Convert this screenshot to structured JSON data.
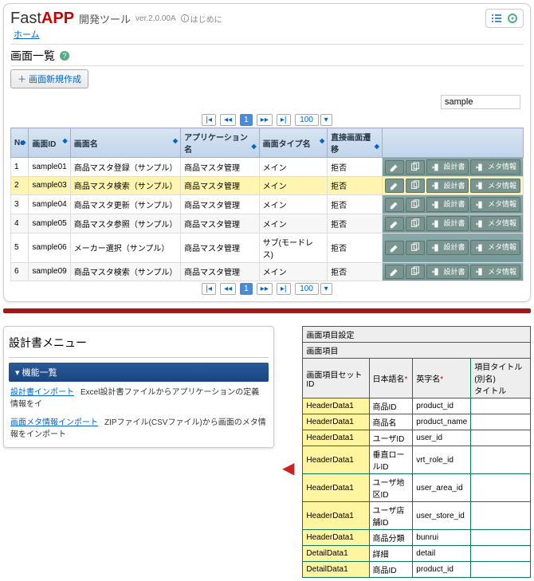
{
  "header": {
    "logo_prefix": "Fast",
    "logo_bold": "APP",
    "subtitle": "開発ツール",
    "version": "ver.2.0.00A",
    "hajime": "はじめに",
    "home": "ホーム"
  },
  "screen_list": {
    "title": "画面一覧",
    "add_button": "＋ 画面新規作成",
    "search_value": "sample",
    "page_size": "100",
    "columns": [
      "No",
      "画面ID",
      "画面名",
      "アプリケーション名",
      "画面タイプ名",
      "直接画面遷移"
    ],
    "action_labels": {
      "design": "設計書",
      "meta": "メタ情報"
    },
    "rows": [
      {
        "no": "1",
        "id": "sample01",
        "name": "商品マスタ登録（サンプル）",
        "app": "商品マスタ管理",
        "type": "メイン",
        "trans": "拒否",
        "sel": false
      },
      {
        "no": "2",
        "id": "sample03",
        "name": "商品マスタ検索（サンプル）",
        "app": "商品マスタ管理",
        "type": "メイン",
        "trans": "拒否",
        "sel": true
      },
      {
        "no": "3",
        "id": "sample04",
        "name": "商品マスタ更新（サンプル）",
        "app": "商品マスタ管理",
        "type": "メイン",
        "trans": "拒否",
        "sel": false
      },
      {
        "no": "4",
        "id": "sample05",
        "name": "商品マスタ参照（サンプル）",
        "app": "商品マスタ管理",
        "type": "メイン",
        "trans": "拒否",
        "sel": false
      },
      {
        "no": "5",
        "id": "sample06",
        "name": "メーカー選択（サンプル）",
        "app": "商品マスタ管理",
        "type": "サブ(モードレス)",
        "trans": "拒否",
        "sel": false
      },
      {
        "no": "6",
        "id": "sample09",
        "name": "商品マスタ検索（サンプル）",
        "app": "商品マスタ管理",
        "type": "メイン",
        "trans": "拒否",
        "sel": false
      }
    ]
  },
  "design_menu": {
    "title": "設計書メニュー",
    "bar": "▾ 機能一覧",
    "items": [
      {
        "link": "設計書インポート",
        "desc": "Excel設計書ファイルからアプリケーションの定義情報をイ"
      },
      {
        "link": "画面メタ情報インポート",
        "desc": "ZIPファイル(CSVファイル)から画面のメタ情報をインポート"
      }
    ]
  },
  "spec": {
    "title1": "画面項目設定",
    "title2": "画面項目",
    "headers": [
      "画面項目セットID",
      "日本語名",
      "英字名",
      "項目タイトル(別名)\nタイトル"
    ],
    "rows": [
      {
        "set": "HeaderData1",
        "jp": "商品ID",
        "en": "product_id",
        "alias": ""
      },
      {
        "set": "HeaderData1",
        "jp": "商品名",
        "en": "product_name",
        "alias": ""
      },
      {
        "set": "HeaderData1",
        "jp": "ユーザID",
        "en": "user_id",
        "alias": ""
      },
      {
        "set": "HeaderData1",
        "jp": "垂直ロールID",
        "en": "vrt_role_id",
        "alias": ""
      },
      {
        "set": "HeaderData1",
        "jp": "ユーザ地区ID",
        "en": "user_area_id",
        "alias": ""
      },
      {
        "set": "HeaderData1",
        "jp": "ユーザ店舗ID",
        "en": "user_store_id",
        "alias": ""
      },
      {
        "set": "HeaderData1",
        "jp": "商品分類",
        "en": "bunrui",
        "alias": ""
      },
      {
        "set": "DetailData1",
        "jp": "詳細",
        "en": "detail",
        "alias": ""
      },
      {
        "set": "DetailData1",
        "jp": "商品ID",
        "en": "product_id",
        "alias": ""
      }
    ]
  }
}
